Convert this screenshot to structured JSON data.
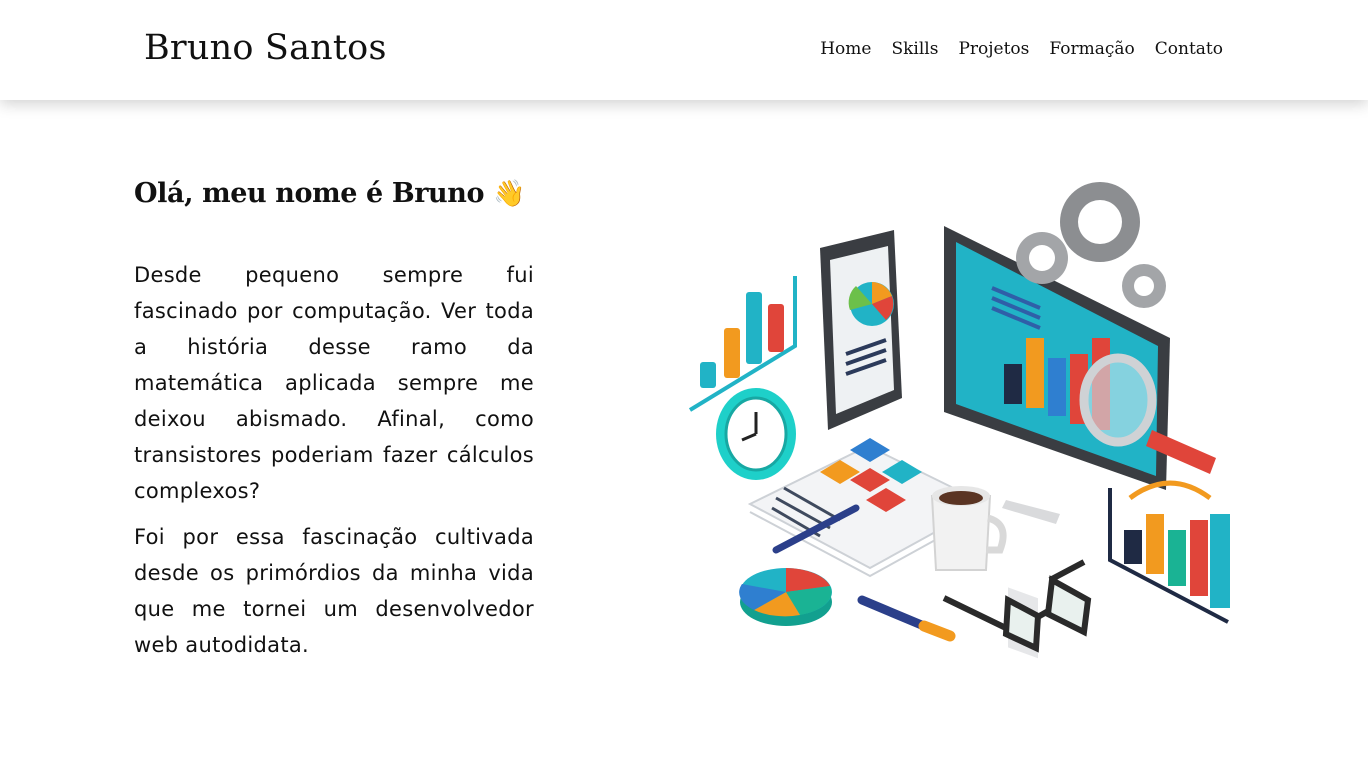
{
  "header": {
    "brand": "Bruno Santos",
    "nav": [
      {
        "label": "Home"
      },
      {
        "label": "Skills"
      },
      {
        "label": "Projetos"
      },
      {
        "label": "Formação"
      },
      {
        "label": "Contato"
      }
    ]
  },
  "hero": {
    "title": "Olá, meu nome é Bruno",
    "title_emoji": "👋",
    "paragraphs": [
      "Desde pequeno sempre fui fascinado por computação. Ver toda a história desse ramo da matemática aplicada sempre me deixou abismado. Afinal, como transistores poderiam fazer cálculos complexos?",
      "Foi por essa fascinação cultivada desde os primórdios da minha vida que me tornei um desenvolvedor web autodidata."
    ]
  },
  "colors": {
    "teal": "#21b3c6",
    "orange": "#f29a1f",
    "red": "#e0453a",
    "navy": "#1f2a44",
    "dark_device": "#3a3d42"
  }
}
